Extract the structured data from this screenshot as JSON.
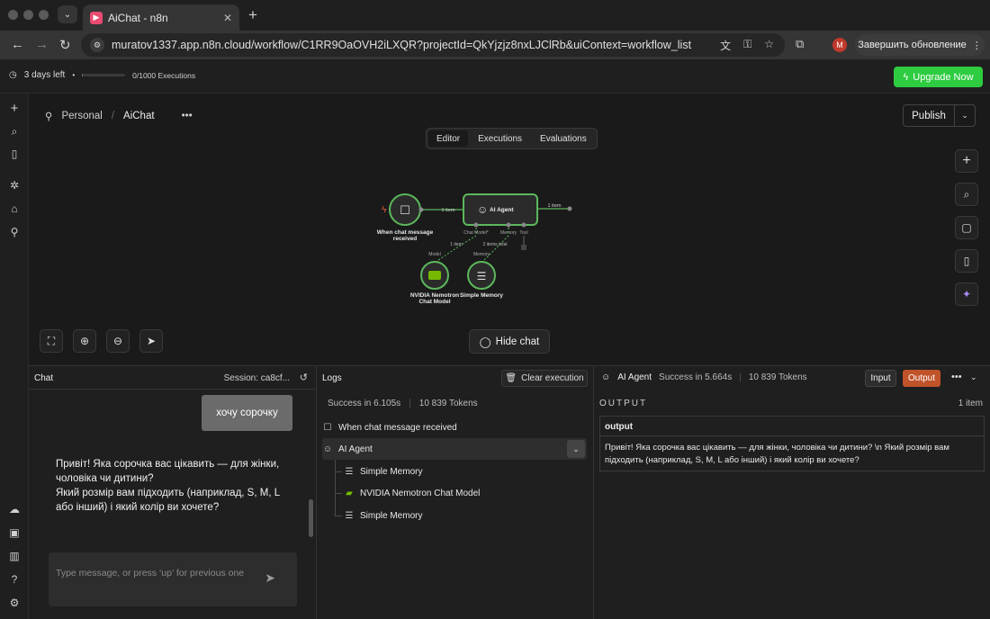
{
  "browser": {
    "tab_title": "AiChat - n8n",
    "url": "muratov1337.app.n8n.cloud/workflow/C1RR9OaOVH2iLXQR?projectId=QkYjzjz8nxLJClRb&uiContext=workflow_list",
    "profile_initial": "M",
    "update_label": "Завершить обновление"
  },
  "trial": {
    "days_left": "3 days left",
    "executions": "0/1000 Executions",
    "progress_fraction": 0.02,
    "upgrade_label": "Upgrade Now"
  },
  "header": {
    "project": "Personal",
    "workflow_name": "AiChat",
    "publish_label": "Publish"
  },
  "canvas": {
    "tabs": [
      {
        "label": "Editor",
        "active": true
      },
      {
        "label": "Executions",
        "active": false
      },
      {
        "label": "Evaluations",
        "active": false
      }
    ],
    "hide_chat_label": "Hide chat",
    "nodes": {
      "trigger": {
        "label_line1": "When chat message",
        "label_line2": "received"
      },
      "agent": {
        "label": "AI Agent"
      },
      "model": {
        "label_line1": "NVIDIA Nemotron",
        "label_line2": "Chat Model"
      },
      "memory": {
        "label": "Simple Memory"
      }
    },
    "edges": {
      "trigger_agent": "1 item",
      "agent_out": "1 item",
      "model_edge": "1 item",
      "memory_edge": "2 items total"
    },
    "ports": {
      "chat_model": "Chat Model*",
      "memory": "Memory",
      "tool": "Tool",
      "model_tag": "Model",
      "memory_tag": "Memory"
    }
  },
  "chat": {
    "title": "Chat",
    "session": "Session: ca8cf...",
    "user_message": "хочу сорочку",
    "bot_message": "Привіт! Яка сорочка вас цікавить — для жінки, чоловіка чи дитини?\nЯкий розмір вам підходить (наприклад, S, M, L або інший) і який колір ви хочете?",
    "input_placeholder": "Type message, or press ‘up’ for previous one"
  },
  "logs": {
    "title": "Logs",
    "clear_label": "Clear execution",
    "summary_time": "Success in 6.105s",
    "summary_tokens": "10 839 Tokens",
    "entries": [
      {
        "label": "When chat message received"
      },
      {
        "label": "AI Agent"
      },
      {
        "label": "Simple Memory"
      },
      {
        "label": "NVIDIA Nemotron Chat Model"
      },
      {
        "label": "Simple Memory"
      }
    ]
  },
  "output": {
    "node": "AI Agent",
    "status": "Success in 5.664s",
    "tokens": "10 839 Tokens",
    "input_label": "Input",
    "output_label": "Output",
    "section_label": "OUTPUT",
    "count": "1 item",
    "column": "output",
    "value": "Привіт! Яка сорочка вас цікавить — для жінки, чоловіка чи дитини?  \\n Який розмір вам підходить (наприклад, S, M, L або інший) і який колір ви хочете?"
  },
  "colors": {
    "accent_green": "#2ecc40",
    "output_active": "#c0532a",
    "node_border": "#5cb85c"
  }
}
